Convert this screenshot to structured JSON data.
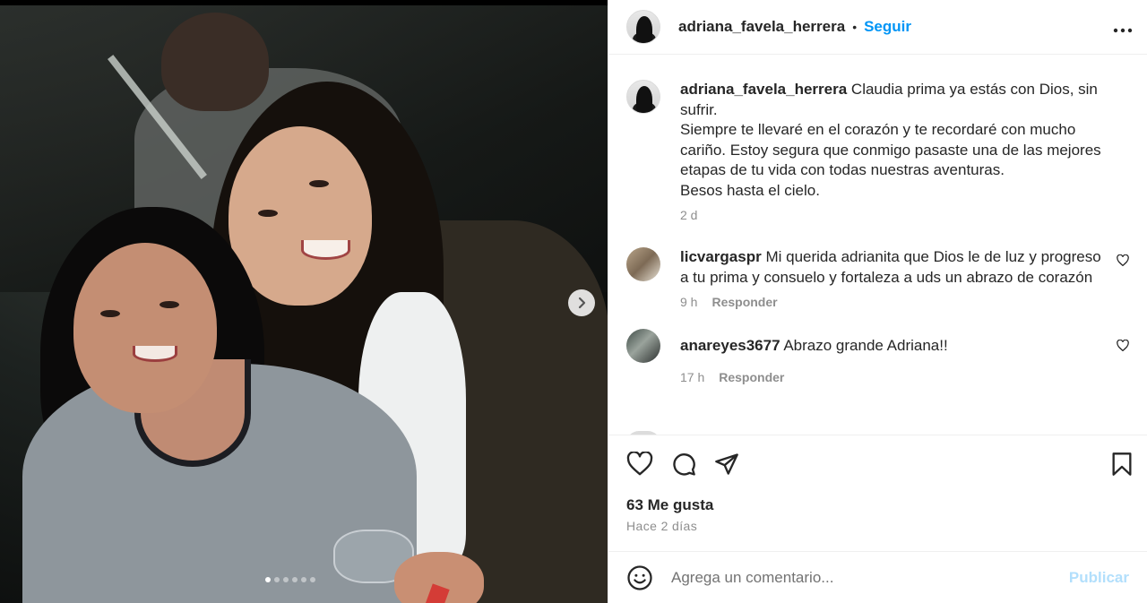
{
  "post": {
    "author": "adriana_favela_herrera",
    "separator": "•",
    "follow_label": "Seguir",
    "more_label": "•••",
    "carousel": {
      "dot_count": 6,
      "active_dot": 0
    }
  },
  "caption": {
    "username": "adriana_favela_herrera",
    "text": "Claudia prima ya estás con Dios, sin sufrir.\nSiempre te llevaré en el corazón y te recordaré con mucho cariño. Estoy segura que conmigo pasaste una de las mejores etapas de tu vida con todas nuestras aventuras.\nBesos hasta el cielo.",
    "age": "2 d"
  },
  "comments": [
    {
      "username": "licvargaspr",
      "text": "Mi querida adrianita que Dios le de luz y progreso a tu prima y consuelo y fortaleza a uds un abrazo de corazón",
      "age": "9 h",
      "reply_label": "Responder"
    },
    {
      "username": "anareyes3677",
      "text": "Abrazo grande Adriana!!",
      "age": "17 h",
      "reply_label": "Responder"
    }
  ],
  "likes": "63 Me gusta",
  "posted": "Hace 2 días",
  "add_comment": {
    "placeholder": "Agrega un comentario...",
    "post_label": "Publicar"
  },
  "colors": {
    "accent": "#0095f6",
    "post_disabled": "#b2dffc",
    "muted": "#8e8e8e"
  },
  "icons": [
    "next-arrow-icon",
    "more-icon",
    "heart-icon",
    "comment-icon",
    "share-icon",
    "bookmark-icon",
    "emoji-icon"
  ]
}
